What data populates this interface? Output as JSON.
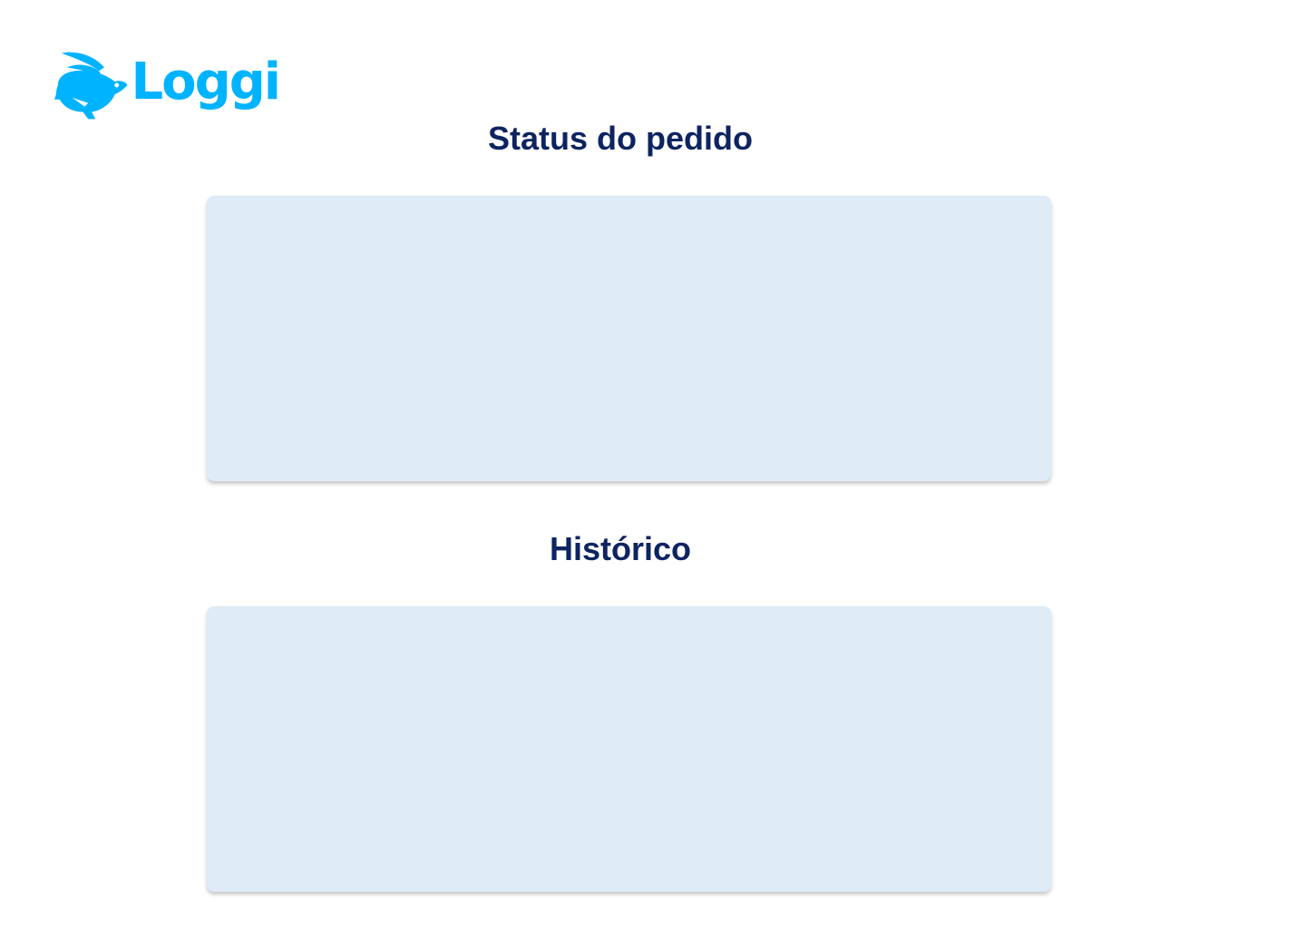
{
  "brand": {
    "name": "Loggi",
    "icon": "rabbit-icon",
    "color": "#00b3ff"
  },
  "colors": {
    "heading": "#0e2461",
    "panel_background": "#dfebf6",
    "page_background": "#ffffff"
  },
  "sections": {
    "status": {
      "title": "Status do pedido"
    },
    "history": {
      "title": "Histórico"
    }
  }
}
